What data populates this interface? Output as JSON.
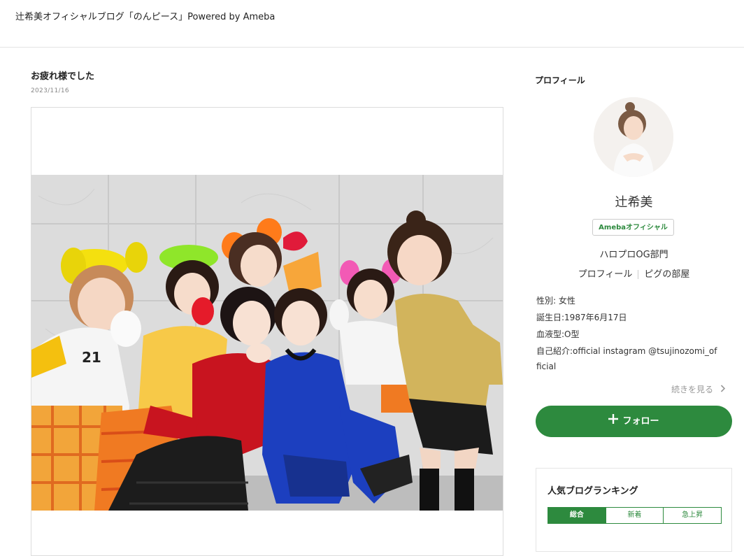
{
  "header": {
    "blog_title": "辻希美オフィシャルブログ「のんピース」Powered by Ameba"
  },
  "article": {
    "title": "お疲れ様でした",
    "date": "2023/11/16",
    "photo_jersey_number": "21"
  },
  "sidebar": {
    "profile_heading": "プロフィール",
    "name": "辻希美",
    "badge": "Amebaオフィシャル",
    "group": "ハロプロOG部門",
    "links": [
      "プロフィール",
      "ピグの部屋"
    ],
    "info": {
      "gender": "性別: 女性",
      "birthday": "誕生日:1987年6月17日",
      "blood": "血液型:O型",
      "intro_line1": "自己紹介:official instagram @tsujinozomi_of",
      "intro_line2": "ficial"
    },
    "more_link": "続きを見る",
    "follow_button": "フォロー",
    "ranking": {
      "title": "人気ブログランキング",
      "tabs": [
        "総合",
        "新着",
        "急上昇"
      ],
      "active_tab": "総合"
    }
  },
  "colors": {
    "accent": "#2d8a3e"
  }
}
